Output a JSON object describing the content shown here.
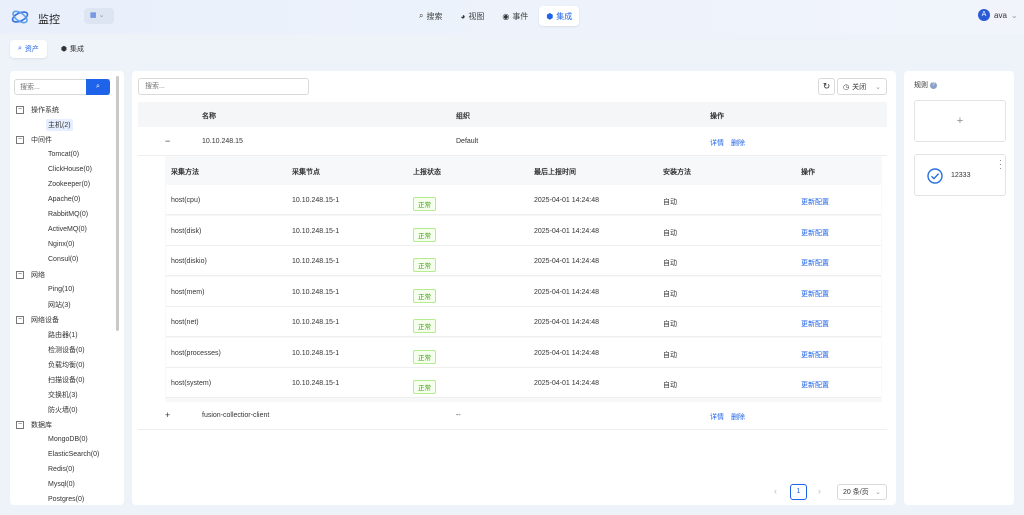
{
  "app": {
    "title": "监控",
    "user": "ava",
    "user_initial": "A"
  },
  "nav": [
    {
      "label": "搜索",
      "icon": "search-icon"
    },
    {
      "label": "视图",
      "icon": "pie-chart-icon"
    },
    {
      "label": "事件",
      "icon": "event-icon"
    },
    {
      "label": "集成",
      "icon": "cube-icon",
      "active": true
    }
  ],
  "subtabs": [
    {
      "label": "资产",
      "active": true
    },
    {
      "label": "集成"
    }
  ],
  "tree": {
    "search_placeholder": "搜索...",
    "groups": [
      {
        "label": "操作系统",
        "toggle": "−",
        "children": [
          "主机(2)"
        ],
        "selected": 0
      },
      {
        "label": "中间件",
        "toggle": "−",
        "children": [
          "Tomcat(0)",
          "ClickHouse(0)",
          "Zookeeper(0)",
          "Apache(0)",
          "RabbitMQ(0)",
          "ActiveMQ(0)",
          "Nginx(0)",
          "Consul(0)"
        ]
      },
      {
        "label": "网络",
        "toggle": "−",
        "children": [
          "Ping(10)",
          "网站(3)"
        ]
      },
      {
        "label": "网络设备",
        "toggle": "−",
        "children": [
          "路由器(1)",
          "检测设备(0)",
          "负载均衡(0)",
          "扫描设备(0)",
          "交换机(3)",
          "防火墙(0)"
        ]
      },
      {
        "label": "数据库",
        "toggle": "−",
        "children": [
          "MongoDB(0)",
          "ElasticSearch(0)",
          "Redis(0)",
          "Mysql(0)",
          "Postgres(0)"
        ]
      }
    ]
  },
  "main": {
    "search_placeholder": "搜索...",
    "auto_refresh": "关闭",
    "columns": [
      "名称",
      "组织",
      "操作"
    ],
    "rows": [
      {
        "expander": "−",
        "name": "10.10.248.15",
        "org": "Default",
        "detail": "详情",
        "delete": "删除"
      },
      {
        "expander": "+",
        "name": "fusion-collectior-client",
        "org": "--",
        "detail": "详情",
        "delete": "删除"
      }
    ],
    "inner_columns": [
      "采集方法",
      "采集节点",
      "上报状态",
      "最后上报时间",
      "安装方法",
      "操作"
    ],
    "inner_rows": [
      {
        "method": "host(cpu)",
        "node": "10.10.248.15-1",
        "status": "正常",
        "time": "2025-04-01 14:24:48",
        "install": "自动",
        "action": "更新配置"
      },
      {
        "method": "host(disk)",
        "node": "10.10.248.15-1",
        "status": "正常",
        "time": "2025-04-01 14:24:48",
        "install": "自动",
        "action": "更新配置"
      },
      {
        "method": "host(diskio)",
        "node": "10.10.248.15-1",
        "status": "正常",
        "time": "2025-04-01 14:24:48",
        "install": "自动",
        "action": "更新配置"
      },
      {
        "method": "host(mem)",
        "node": "10.10.248.15-1",
        "status": "正常",
        "time": "2025-04-01 14:24:48",
        "install": "自动",
        "action": "更新配置"
      },
      {
        "method": "host(net)",
        "node": "10.10.248.15-1",
        "status": "正常",
        "time": "2025-04-01 14:24:48",
        "install": "自动",
        "action": "更新配置"
      },
      {
        "method": "host(processes)",
        "node": "10.10.248.15-1",
        "status": "正常",
        "time": "2025-04-01 14:24:48",
        "install": "自动",
        "action": "更新配置"
      },
      {
        "method": "host(system)",
        "node": "10.10.248.15-1",
        "status": "正常",
        "time": "2025-04-01 14:24:48",
        "install": "自动",
        "action": "更新配置"
      }
    ],
    "pagination": {
      "current": "1",
      "page_size": "20 条/页"
    }
  },
  "rules": {
    "title": "规则",
    "add_symbol": "+",
    "items": [
      {
        "name": "12333"
      }
    ]
  },
  "colors": {
    "accent": "#1e63e9",
    "success": "#389e0d"
  }
}
